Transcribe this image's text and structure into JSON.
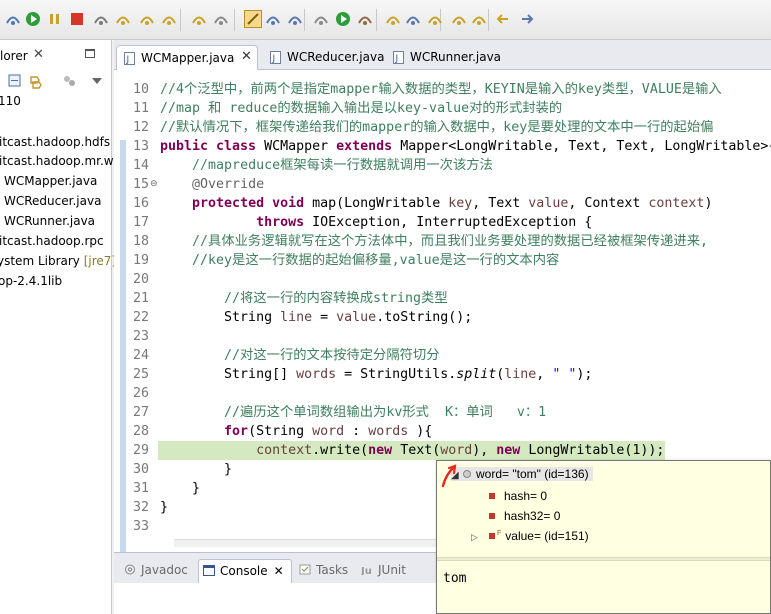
{
  "toolbar": {
    "icons": [
      "debug-icon",
      "resume-icon",
      "suspend-icon",
      "terminate-icon",
      "disconnect-icon",
      "step-into-icon",
      "step-over-icon",
      "step-return-icon",
      "drop-to-frame-icon",
      "use-step-filters-icon",
      "toggle-mark-occurrences-icon",
      "toggle-word-wrap-icon",
      "show-whitespace-icon",
      "skip-breakpoints-icon",
      "run-icon",
      "coverage-icon",
      "new-java-package-icon",
      "open-type-icon",
      "search-icon",
      "next-annotation-icon",
      "previous-annotation-icon",
      "back-icon",
      "forward-icon"
    ]
  },
  "explorer": {
    "tab_label": "lorer",
    "close_glyph": "✕",
    "items": [
      {
        "text": "110",
        "muted": ""
      },
      {
        "text": "itcast.hadoop.hdfs",
        "muted": ""
      },
      {
        "text": "itcast.hadoop.mr.w",
        "muted": ""
      },
      {
        "text": "WCMapper.java",
        "muted": ""
      },
      {
        "text": "WCReducer.java",
        "muted": ""
      },
      {
        "text": "WCRunner.java",
        "muted": ""
      },
      {
        "text": "itcast.hadoop.rpc",
        "muted": ""
      },
      {
        "text": "ystem Library ",
        "muted": "[jre7]"
      },
      {
        "text": "op-2.4.1lib",
        "muted": ""
      }
    ]
  },
  "editor_tabs": [
    {
      "label": "WCMapper.java",
      "active": true,
      "close": "✕"
    },
    {
      "label": "WCReducer.java",
      "active": false,
      "close": ""
    },
    {
      "label": "WCRunner.java",
      "active": false,
      "close": ""
    }
  ],
  "code": {
    "lines": [
      {
        "n": "10",
        "segs": [
          [
            "cm",
            "//4个泛型中，前两个是指定mapper输入数据的类型，KEYIN是输入的key类型，VALUE是输入"
          ]
        ]
      },
      {
        "n": "11",
        "segs": [
          [
            "cm",
            "//map 和 reduce的数据输入输出是以key-value对的形式封装的"
          ]
        ]
      },
      {
        "n": "12",
        "segs": [
          [
            "cm",
            "//默认情况下，框架传递给我们的mapper的输入数据中，key是要处理的文本中一行的起始偏"
          ]
        ]
      },
      {
        "n": "13",
        "segs": [
          [
            "kw",
            "public class "
          ],
          [
            "",
            "WCMapper "
          ],
          [
            "kw",
            "extends "
          ],
          [
            "",
            "Mapper<LongWritable, Text, Text, LongWritable>{"
          ]
        ]
      },
      {
        "n": "14",
        "segs": [
          [
            "",
            "    "
          ],
          [
            "cm",
            "//mapreduce框架每读一行数据就调用一次该方法"
          ]
        ]
      },
      {
        "n": "15",
        "segs": [
          [
            "",
            "    "
          ],
          [
            "an",
            "@Override"
          ]
        ]
      },
      {
        "n": "16",
        "segs": [
          [
            "",
            "    "
          ],
          [
            "kw",
            "protected void "
          ],
          [
            "",
            "map(LongWritable "
          ],
          [
            "pv",
            "key"
          ],
          [
            "",
            ", Text "
          ],
          [
            "pv",
            "value"
          ],
          [
            "",
            ", Context "
          ],
          [
            "pv",
            "context"
          ],
          [
            "",
            ")"
          ]
        ]
      },
      {
        "n": "17",
        "segs": [
          [
            "",
            "            "
          ],
          [
            "kw",
            "throws "
          ],
          [
            "",
            "IOException, InterruptedException {"
          ]
        ]
      },
      {
        "n": "18",
        "segs": [
          [
            "",
            "    "
          ],
          [
            "cm",
            "//具体业务逻辑就写在这个方法体中，而且我们业务要处理的数据已经被框架传递进来,"
          ]
        ]
      },
      {
        "n": "19",
        "segs": [
          [
            "",
            "    "
          ],
          [
            "cm",
            "//key是这一行数据的起始偏移量,value是这一行的文本内容"
          ]
        ]
      },
      {
        "n": "20",
        "segs": []
      },
      {
        "n": "21",
        "segs": [
          [
            "",
            "        "
          ],
          [
            "cm",
            "//将这一行的内容转换成string类型"
          ]
        ]
      },
      {
        "n": "22",
        "segs": [
          [
            "",
            "        String "
          ],
          [
            "pv",
            "line"
          ],
          [
            "",
            " = "
          ],
          [
            "pv",
            "value"
          ],
          [
            "",
            ".toString();"
          ]
        ]
      },
      {
        "n": "23",
        "segs": []
      },
      {
        "n": "24",
        "segs": [
          [
            "",
            "        "
          ],
          [
            "cm",
            "//对这一行的文本按待定分隔符切分"
          ]
        ]
      },
      {
        "n": "25",
        "segs": [
          [
            "",
            "        String[] "
          ],
          [
            "pv",
            "words"
          ],
          [
            "",
            " = StringUtils."
          ],
          [
            "it",
            "split"
          ],
          [
            "",
            "("
          ],
          [
            "pv",
            "line"
          ],
          [
            "",
            ", "
          ],
          [
            "st",
            "\" \""
          ],
          [
            "",
            ");"
          ]
        ]
      },
      {
        "n": "26",
        "segs": []
      },
      {
        "n": "27",
        "segs": [
          [
            "",
            "        "
          ],
          [
            "cm",
            "//遍历这个单词数组输出为kv形式  K：单词   v：1"
          ]
        ]
      },
      {
        "n": "28",
        "segs": [
          [
            "",
            "        "
          ],
          [
            "kw",
            "for"
          ],
          [
            "",
            "(String "
          ],
          [
            "pv",
            "word"
          ],
          [
            "",
            " : "
          ],
          [
            "pv",
            "words"
          ],
          [
            "",
            " ){"
          ]
        ]
      },
      {
        "n": "29",
        "segs": [
          [
            "",
            "            "
          ],
          [
            "pv",
            "context"
          ],
          [
            "",
            ".write("
          ],
          [
            "kw",
            "new "
          ],
          [
            "",
            "Text("
          ],
          [
            "pv",
            "word"
          ],
          [
            "",
            "), "
          ],
          [
            "kw",
            "new "
          ],
          [
            "",
            "LongWritable(1));"
          ]
        ]
      },
      {
        "n": "30",
        "segs": [
          [
            "",
            "        }"
          ]
        ]
      },
      {
        "n": "31",
        "segs": [
          [
            "",
            "    }"
          ]
        ]
      },
      {
        "n": "32",
        "segs": [
          [
            "",
            "}"
          ]
        ]
      },
      {
        "n": "33",
        "segs": []
      }
    ],
    "highlight_line": "29",
    "highlight_color": "#d4e9c0",
    "fold_markers": {
      "15": "⊖"
    }
  },
  "bottom_tabs": [
    {
      "label": "Javadoc",
      "active": false,
      "icon": "at-icon"
    },
    {
      "label": "Console",
      "active": true,
      "icon": "console-icon",
      "close": "✕"
    },
    {
      "label": "Tasks",
      "active": false,
      "icon": "tasks-icon"
    },
    {
      "label": "JUnit",
      "active": false,
      "icon": "junit-icon",
      "prefix": "Ju"
    }
  ],
  "debug_popup": {
    "root": "word= \"tom\" (id=136)",
    "children": [
      {
        "text": "hash= 0",
        "expandable": false
      },
      {
        "text": "hash32= 0",
        "expandable": false
      },
      {
        "text": "value= (id=151)",
        "expandable": true,
        "final_marker": "F"
      }
    ],
    "detail": "tom"
  }
}
